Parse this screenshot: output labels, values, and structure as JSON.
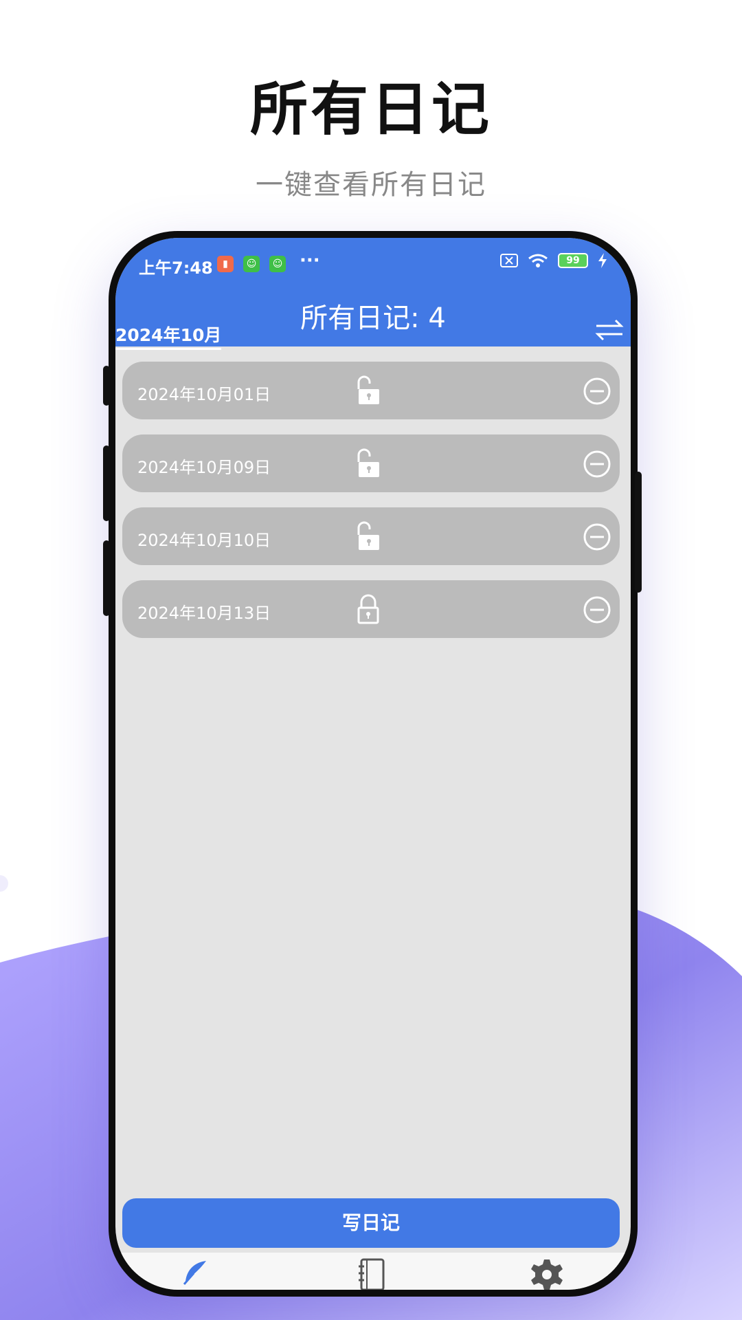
{
  "promo": {
    "title": "所有日记",
    "subtitle": "一键查看所有日记"
  },
  "status_bar": {
    "time": "上午7:48",
    "dots": "···",
    "battery": "99",
    "icons": [
      "trash-icon",
      "app-icon",
      "app-icon",
      "sim-off-icon",
      "wifi-icon",
      "battery-icon",
      "charging-icon"
    ]
  },
  "header": {
    "title": "所有日记: 4",
    "month_tab": "2024年10月",
    "switch_icon": "swap-arrows-icon"
  },
  "entries": [
    {
      "date": "2024年10月01日",
      "lock": "unlocked-icon"
    },
    {
      "date": "2024年10月09日",
      "lock": "unlocked-icon"
    },
    {
      "date": "2024年10月10日",
      "lock": "unlocked-icon"
    },
    {
      "date": "2024年10月13日",
      "lock": "locked-icon"
    }
  ],
  "write_button": "写日记",
  "tabbar": {
    "tabs": [
      "feather-icon",
      "notebook-icon",
      "gear-icon"
    ]
  },
  "colors": {
    "primary": "#4279e5",
    "row_bg": "#bbbbbb",
    "screen_bg": "#e4e4e4",
    "accent_purple": "#8d80ea"
  }
}
